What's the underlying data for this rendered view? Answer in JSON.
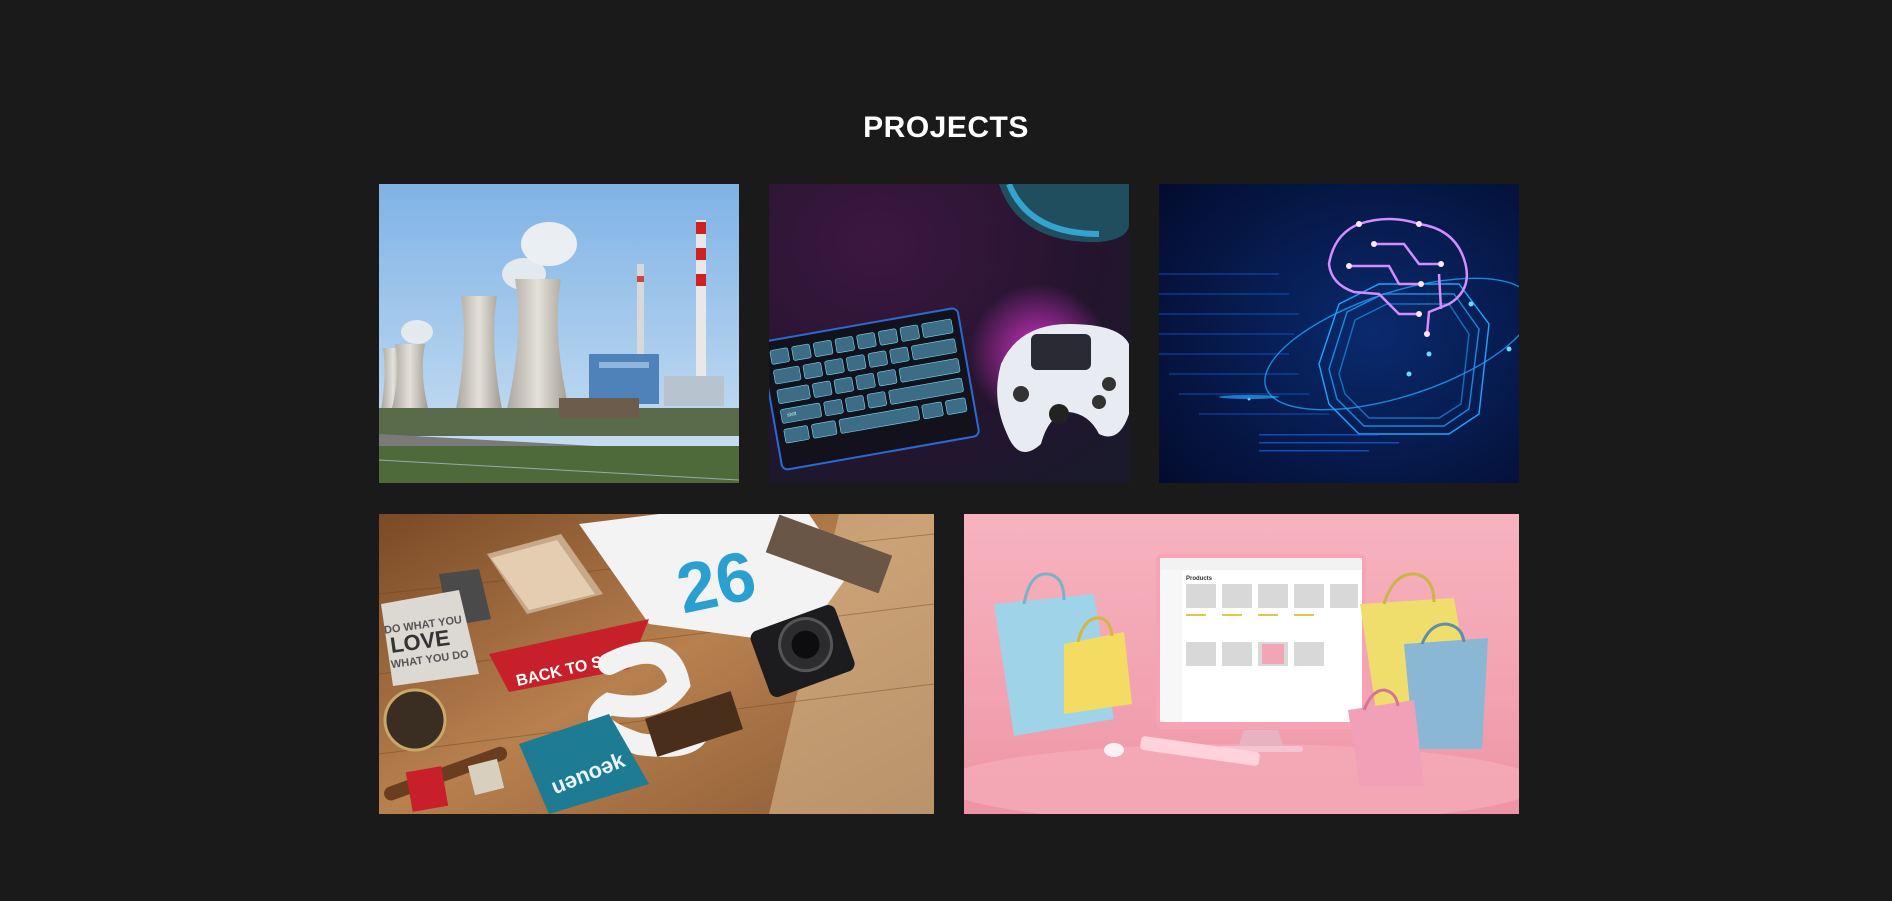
{
  "section": {
    "title": "PROJECTS"
  },
  "projects": [
    {
      "image": "power-plant-cooling-towers"
    },
    {
      "image": "gaming-keyboard-and-controller"
    },
    {
      "image": "neon-circuit-brain"
    },
    {
      "image": "branding-mockup-desk"
    },
    {
      "image": "ecommerce-computer-shopping-bags"
    }
  ],
  "visible_text": {
    "keyboard_key": "shift",
    "pennant": "BACK TO SCHOOL",
    "poster_line_1": "DO WHAT YOU",
    "poster_line_2": "LOVE",
    "poster_line_3": "WHAT YOU DO",
    "tee_number": "26",
    "book_cover": "uənoək",
    "screen_heading": "Products"
  },
  "colors": {
    "page_background": "#1a1a1a",
    "title": "#ffffff"
  }
}
